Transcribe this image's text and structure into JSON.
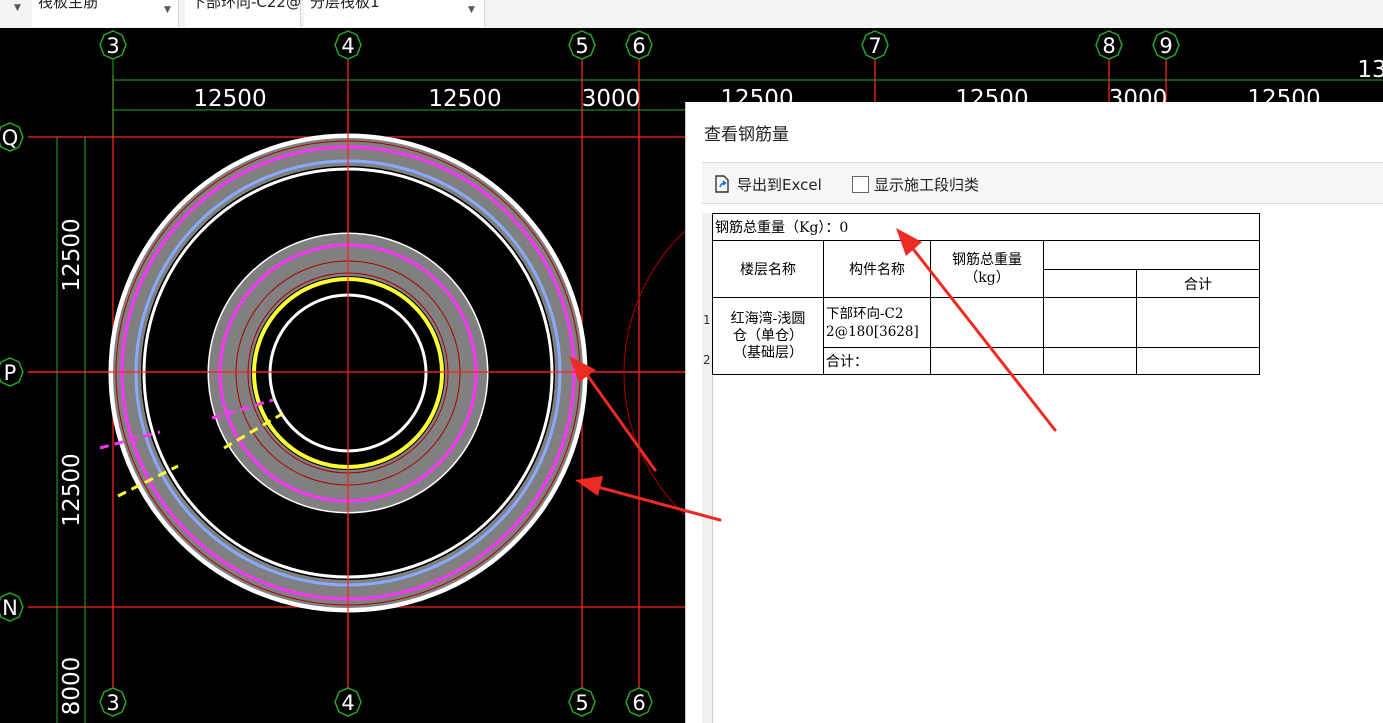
{
  "toolbar": {
    "combo_1": "筏板主筋",
    "combo_2": "下部环向-C22@",
    "combo_3": "分层筏板1"
  },
  "cad": {
    "axis_top": [
      "3",
      "4",
      "5",
      "6",
      "7",
      "8",
      "9"
    ],
    "axis_bottom": [
      "3",
      "4",
      "5",
      "6"
    ],
    "axis_left": [
      "Q",
      "P",
      "N"
    ],
    "dims_top": [
      "12500",
      "12500",
      "3000",
      "12500",
      "12500",
      "3000",
      "12500"
    ],
    "dims_top_edge": "13",
    "dims_left": [
      "12500",
      "12500",
      "8000"
    ],
    "colors": {
      "grid": "#ff2020",
      "magenta": "#ff33ff",
      "blue": "#88aaff",
      "yellow": "#ffff33",
      "ring": "#808080"
    }
  },
  "dialog": {
    "title": "查看钢筋量",
    "export_label": "导出到Excel",
    "show_stage_label": "显示施工段归类",
    "total_weight": "钢筋总重量（Kg）：0",
    "col_floor": "楼层名称",
    "col_component": "构件名称",
    "col_total_line1": "钢筋总重量",
    "col_total_line2": "（kg）",
    "col_sum": "合计",
    "row_numbers": [
      "1",
      "2"
    ],
    "floor_line1": "红海湾-浅圆",
    "floor_line2": "仓（单仓）",
    "floor_line3": "（基础层）",
    "component_line1": "下部环向-C2",
    "component_line2": "2@180[3628]",
    "subtotal_label": "合计："
  }
}
